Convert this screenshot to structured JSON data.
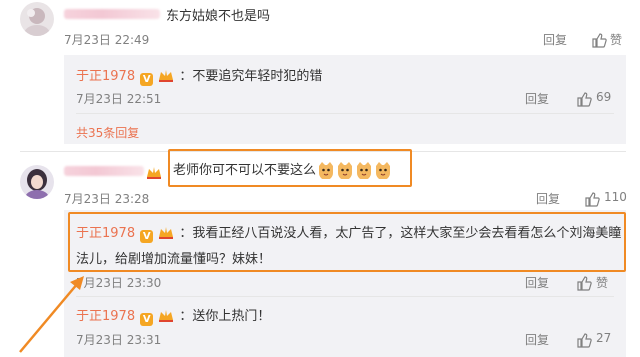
{
  "comments": [
    {
      "text": "东方姑娘不也是吗",
      "time": "7月23日 22:49",
      "reply_label": "回复",
      "replies": [
        {
          "name": "于正1978",
          "text": "：不要追究年轻时犯的错",
          "time": "7月23日 22:51",
          "reply_label": "回复",
          "likes": "69"
        }
      ],
      "more_replies": "共35条回复"
    },
    {
      "text": "老师你可不可以不要这么",
      "time": "7月23日 23:28",
      "reply_label": "回复",
      "likes": "110",
      "replies": [
        {
          "name": "于正1978",
          "text_line1": "：我看正经八百说没人看，太广告了，这样大家至少会去看看怎么个刘海美瞳",
          "text_line2": "法儿，给剧增加流量懂吗？妹妹！",
          "time": "7月23日 23:30",
          "reply_label": "回复",
          "likes": ""
        },
        {
          "name": "于正1978",
          "text": "：送你上热门！",
          "time": "7月23日 23:31",
          "reply_label": "回复",
          "likes": "27"
        }
      ]
    }
  ],
  "colors": {
    "accent_name": "#eb7350",
    "highlight_box": "#f08a24",
    "reply_bg": "#f2f2f5"
  },
  "icons": [
    "thumb-up-icon",
    "verified-v-icon",
    "crown-badge-icon",
    "cat-emoji-icon",
    "arrow-annotation"
  ]
}
